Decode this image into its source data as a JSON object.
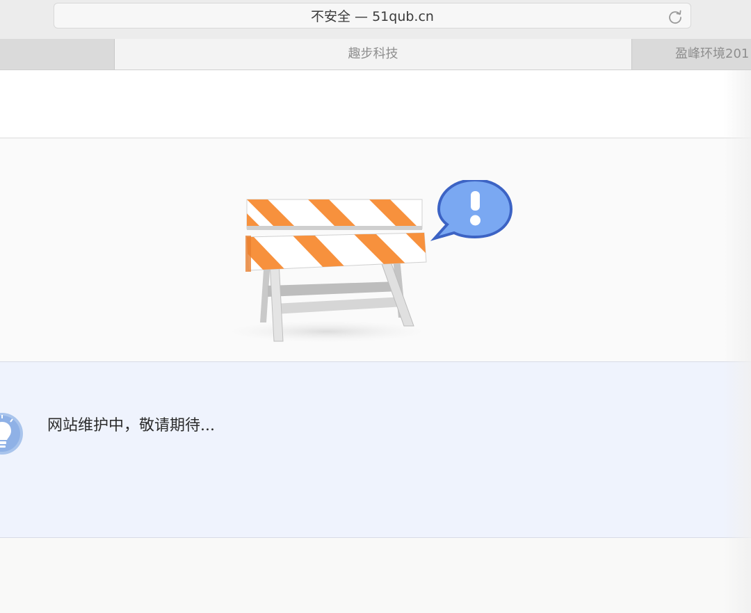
{
  "browser": {
    "address_text": "不安全 — 51qub.cn",
    "reload_icon": "reload-icon",
    "tabs": [
      {
        "label": ""
      },
      {
        "label": "趣步科技"
      },
      {
        "label": "盈峰环境201"
      }
    ]
  },
  "page": {
    "illustration": "road-barrier-with-exclamation-bubble",
    "notice_icon": "lightbulb-icon",
    "notice_text": "网站维护中，敬请期待..."
  },
  "colors": {
    "barrier_orange": "#f7913d",
    "bubble_blue": "#6f9ff0",
    "notice_bg": "#eff3fd"
  }
}
